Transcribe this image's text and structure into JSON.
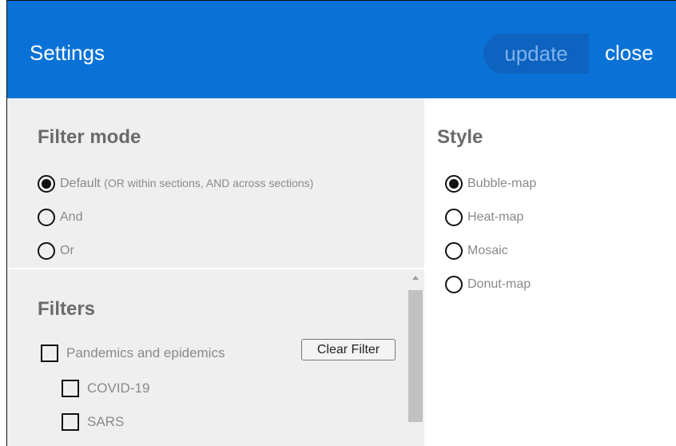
{
  "header": {
    "title": "Settings",
    "update_label": "update",
    "close_label": "close",
    "bg_color": "#0a72d6"
  },
  "filter_mode": {
    "title": "Filter mode",
    "options": [
      {
        "label": "Default",
        "note": "(OR within sections, AND across sections)",
        "checked": true
      },
      {
        "label": "And",
        "checked": false
      },
      {
        "label": "Or",
        "checked": false
      }
    ]
  },
  "filters": {
    "title": "Filters",
    "clear_label": "Clear Filter",
    "items": [
      {
        "label": "Pandemics and epidemics",
        "checked": false,
        "level": 0
      },
      {
        "label": "COVID-19",
        "checked": false,
        "level": 1
      },
      {
        "label": "SARS",
        "checked": false,
        "level": 1
      }
    ]
  },
  "style": {
    "title": "Style",
    "options": [
      {
        "label": "Bubble-map",
        "checked": true
      },
      {
        "label": "Heat-map",
        "checked": false
      },
      {
        "label": "Mosaic",
        "checked": false
      },
      {
        "label": "Donut-map",
        "checked": false
      }
    ]
  }
}
